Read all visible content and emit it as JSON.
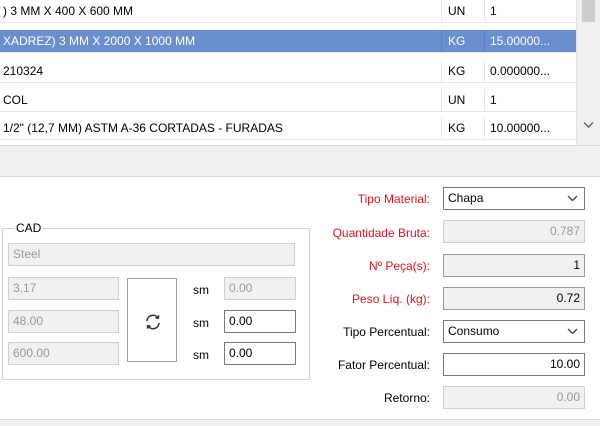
{
  "grid": {
    "rows": [
      {
        "desc": ") 3 MM X 400 X 600 MM",
        "unit": "UN",
        "qty": "1",
        "selected": false
      },
      {
        "desc": "XADREZ) 3 MM X 2000 X 1000 MM",
        "unit": "KG",
        "qty": "15.00000...",
        "selected": true
      },
      {
        "desc": " 210324",
        "unit": "KG",
        "qty": "0.000000...",
        "selected": false
      },
      {
        "desc": "COL",
        "unit": "UN",
        "qty": "1",
        "selected": false
      },
      {
        "desc": "1/2\" (12,7 MM) ASTM A-36 CORTADAS - FURADAS",
        "unit": "KG",
        "qty": "10.00000...",
        "selected": false
      }
    ]
  },
  "cad": {
    "title": "CAD",
    "material": "Steel",
    "dims": [
      "3.17",
      "48.00",
      "600.00"
    ],
    "unit_labels": [
      "sm",
      "sm",
      "sm"
    ],
    "sm_values": [
      "0.00",
      "0.00",
      "0.00"
    ]
  },
  "form": {
    "tipo_material_label": "Tipo Material:",
    "tipo_material_value": "Chapa",
    "quantidade_bruta_label": "Quantidade Bruta:",
    "quantidade_bruta_value": "0.787",
    "n_peca_label": "Nº Peça(s):",
    "n_peca_value": "1",
    "peso_liq_label": "Peso Líq. (kg):",
    "peso_liq_value": "0.72",
    "tipo_percentual_label": "Tipo Percentual:",
    "tipo_percentual_value": "Consumo",
    "fator_percentual_label": "Fator Percentual:",
    "fator_percentual_value": "10.00",
    "retorno_label": "Retorno:",
    "retorno_value": "0.00"
  },
  "colors": {
    "selection": "#6b8ecf",
    "required_label": "#e0141c"
  },
  "icons": {
    "swap": "refresh-icon",
    "dropdown": "chevron-down-icon",
    "scroll": "chevron-down-icon"
  }
}
